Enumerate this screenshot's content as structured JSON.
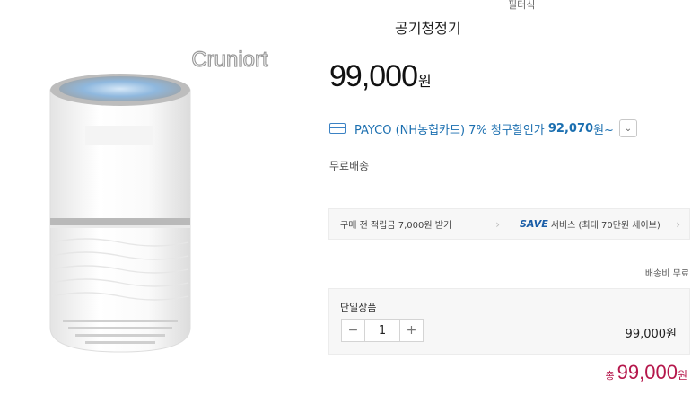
{
  "header": {
    "filter_tab": "필터식"
  },
  "product": {
    "title": "공기청정기",
    "brand_text": "Cruniort",
    "price": "99,000",
    "price_unit": "원"
  },
  "payco": {
    "icon": "card-icon",
    "text": "PAYCO (NH농협카드) 7% 청구할인가",
    "discount_price": "92,070",
    "suffix": "원~",
    "toggle_icon": "chevron-down-icon"
  },
  "shipping": {
    "label": "무료배송"
  },
  "benefits": [
    {
      "label": "구매 전 적립금 7,000원 받기"
    },
    {
      "save_word": "SAVE",
      "label": "서비스 (최대 70만원 세이브)"
    }
  ],
  "delivery_fee": "배송비 무료",
  "option": {
    "name": "단일상품",
    "quantity": "1",
    "minus": "−",
    "plus": "+",
    "price": "99,000원"
  },
  "total": {
    "label": "총",
    "amount": "99,000",
    "unit": "원"
  },
  "colors": {
    "accent_blue": "#1b6fb0",
    "total_pink": "#b5174b"
  }
}
